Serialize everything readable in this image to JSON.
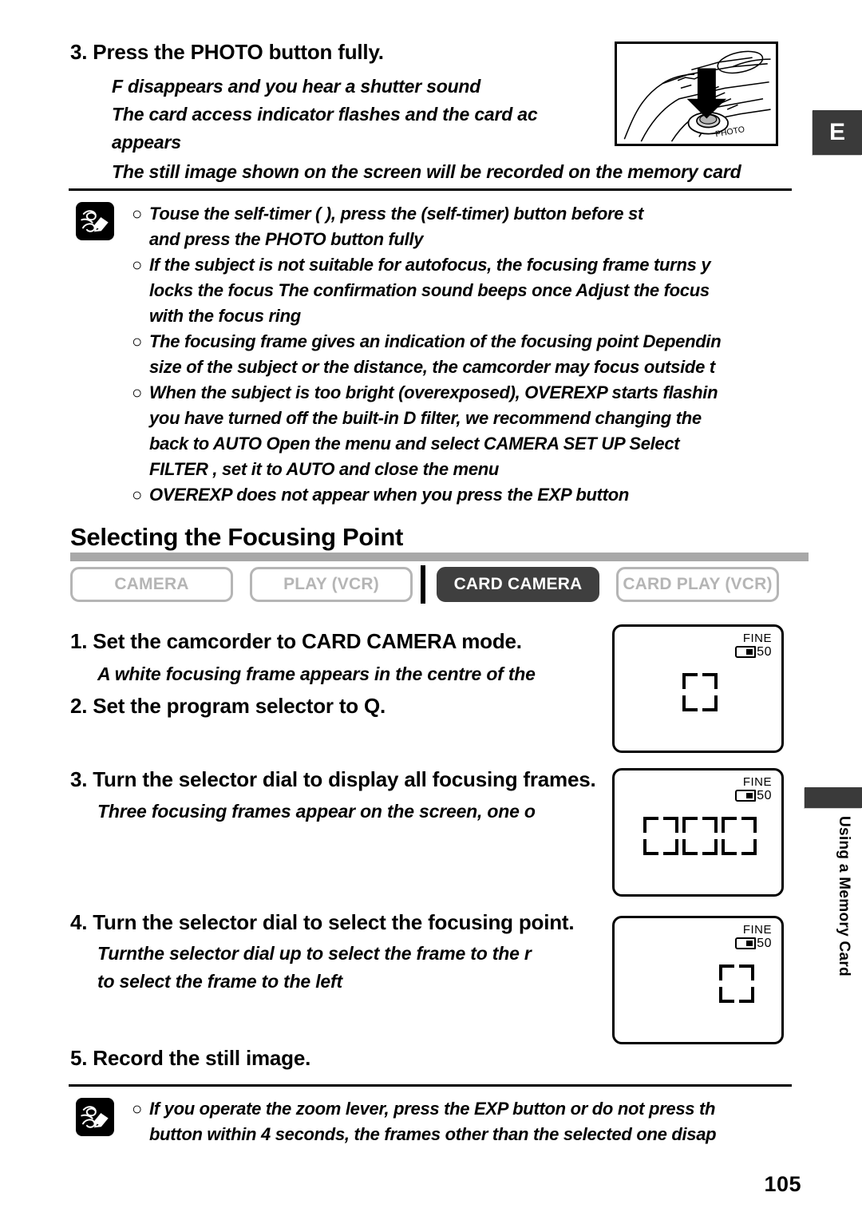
{
  "language_tab": "E",
  "chapter_label": "Using a Memory Card",
  "page_number": "105",
  "top_step": {
    "heading": "3. Press the PHOTO button fully.",
    "lines": [
      "F  disappears and you hear a shutter sound",
      "The card access indicator flashes and the card ac",
      "appears",
      "The still image shown on the screen will be recorded on the memory card"
    ]
  },
  "photo_illustration": {
    "button_label": "PHOTO",
    "arrow": "press-down-arrow"
  },
  "notes_top": {
    "icon": "notes-pencil-icon",
    "items": [
      {
        "bullet": "○",
        "lines": [
          "Touse the self-timer (        ), press the      (self-timer) button before st",
          "and press the PHOTO button fully"
        ]
      },
      {
        "bullet": "○",
        "lines": [
          "If the subject is not suitable for autofocus, the focusing frame turns y",
          "locks the focus  The confirmation sound beeps once  Adjust the focus",
          "with the focus ring"
        ]
      },
      {
        "bullet": "○",
        "lines": [
          "The focusing frame gives an indication of the focusing point  Dependin",
          "size of the subject or the distance, the camcorder may focus outside t"
        ]
      },
      {
        "bullet": "○",
        "lines": [
          "When the subject is too bright (overexposed), OVEREXP starts flashin",
          "you have turned off the built-in   D filter, we recommend changing the",
          "back to AUTO  Open the menu and select  CAMERA SET UP  Select",
          "FILTER , set it to  AUTO  and close the menu"
        ]
      },
      {
        "bullet": "○",
        "lines": [
          "OVEREXP does not appear when you press the EXP button"
        ]
      }
    ]
  },
  "section": {
    "title": "Selecting the Focusing Point",
    "modes": [
      {
        "label": "CAMERA",
        "active": false
      },
      {
        "label": "PLAY (VCR)",
        "active": false
      },
      {
        "label": "CARD CAMERA",
        "active": true
      },
      {
        "label": "CARD PLAY (VCR)",
        "active": false
      }
    ]
  },
  "steps": [
    {
      "heading": "1. Set the camcorder to CARD CAMERA mode.",
      "sub": "A white focusing frame appears in the centre of the"
    },
    {
      "heading": "2. Set the program selector to Q.",
      "sub": ""
    },
    {
      "heading": "3. Turn the selector dial to display all focusing frames.",
      "sub": "Three focusing frames appear on the screen, one o"
    },
    {
      "heading": "4. Turn the selector dial to select the focusing point.",
      "sub": "Turnthe selector dial up to select the frame to the r",
      "sub2": "to select the frame to the left"
    },
    {
      "heading": "5. Record the still image.",
      "sub": ""
    }
  ],
  "lcd_screens": [
    {
      "quality": "FINE",
      "count": "50",
      "frames": [
        "center"
      ]
    },
    {
      "quality": "FINE",
      "count": "50",
      "frames": [
        "left",
        "center",
        "right"
      ]
    },
    {
      "quality": "FINE",
      "count": "50",
      "frames": [
        "right"
      ]
    }
  ],
  "notes_bottom": {
    "icon": "notes-pencil-icon",
    "items": [
      {
        "bullet": "○",
        "lines": [
          "If you operate the zoom lever, press the EXP button or do not press th",
          "button within 4 seconds, the frames other than the selected one disap"
        ]
      }
    ]
  }
}
